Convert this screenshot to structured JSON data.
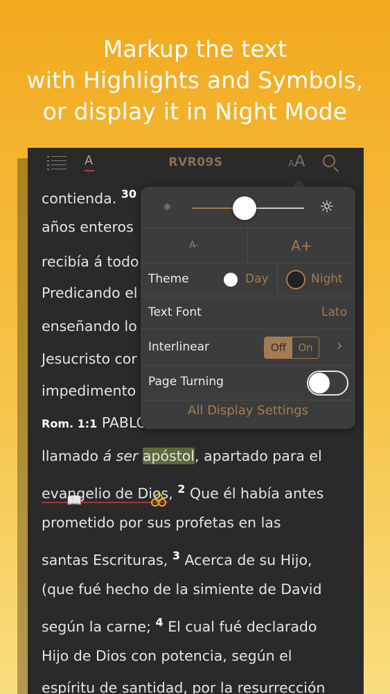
{
  "headline": {
    "line1": "Markup the text",
    "line2": "with Highlights and Symbols,",
    "line3": "or display it in Night Mode"
  },
  "toolbar": {
    "font_a": "A",
    "version": "RVR09S",
    "aa_small": "A",
    "aa_big": "A"
  },
  "text": {
    "l1": "contienda.",
    "l1_sup": "30",
    "l2": "años enteros",
    "l3": "recibía á todo",
    "l4": "Predicando el",
    "l5": "enseñando lo",
    "l6": "Jesucristo cor",
    "l7": "impedimento",
    "l8_ref": "Rom. 1:1",
    "l8_text": "PABLO,",
    "l9_a": "llamado ",
    "l9_italic": "á ser",
    "l9_hl": "apóstol",
    "l9_b": ", apartado para el",
    "l10_ul": "evangelio de Dios",
    "l10_a": ",",
    "l10_sup": "2",
    "l10_b": "Que él había antes",
    "l11": "prometido por sus profetas en las",
    "l12_a": "santas Escrituras,",
    "l12_sup": "3",
    "l12_b": "Acerca de su Hijo,",
    "l13": "(que fué hecho de la simiente de David",
    "l14_a": "según la carne;",
    "l14_sup": "4",
    "l14_b": "El cual fué declarado",
    "l15": "Hijo de Dios con potencia, según el",
    "l16": "espíritu de santidad, por la resurrección"
  },
  "display_settings": {
    "font_size_smaller": "A-",
    "font_size_larger": "A+",
    "brightness": 0.47,
    "theme_label": "Theme",
    "theme_day": "Day",
    "theme_night": "Night",
    "selected_theme": "Night",
    "font_label": "Text Font",
    "font_value": "Lato",
    "interlinear_label": "Interlinear",
    "interlinear_off": "Off",
    "interlinear_on": "On",
    "interlinear_selected": "Off",
    "page_turning_label": "Page Turning",
    "page_turning_on": false,
    "all_settings": "All Display Settings"
  },
  "icons": {
    "list": "list-icon",
    "font": "font-icon",
    "text_size": "text-size-icon",
    "search": "search-icon",
    "sun_small": "brightness-low-icon",
    "sun_big": "brightness-high-icon",
    "chevron": "chevron-right-icon",
    "book": "book-icon",
    "rings": "rings-icon"
  },
  "colors": {
    "accent": "#a47b52",
    "background_gradient_top": "#f2a91e",
    "background_gradient_bottom": "#f9de7e",
    "night_bg": "#2a2a2a",
    "popover_bg": "#3c3c3c",
    "highlight": "#5c6a3a",
    "underline_red": "#a03a3a",
    "symbol_gold": "#e1b126"
  }
}
